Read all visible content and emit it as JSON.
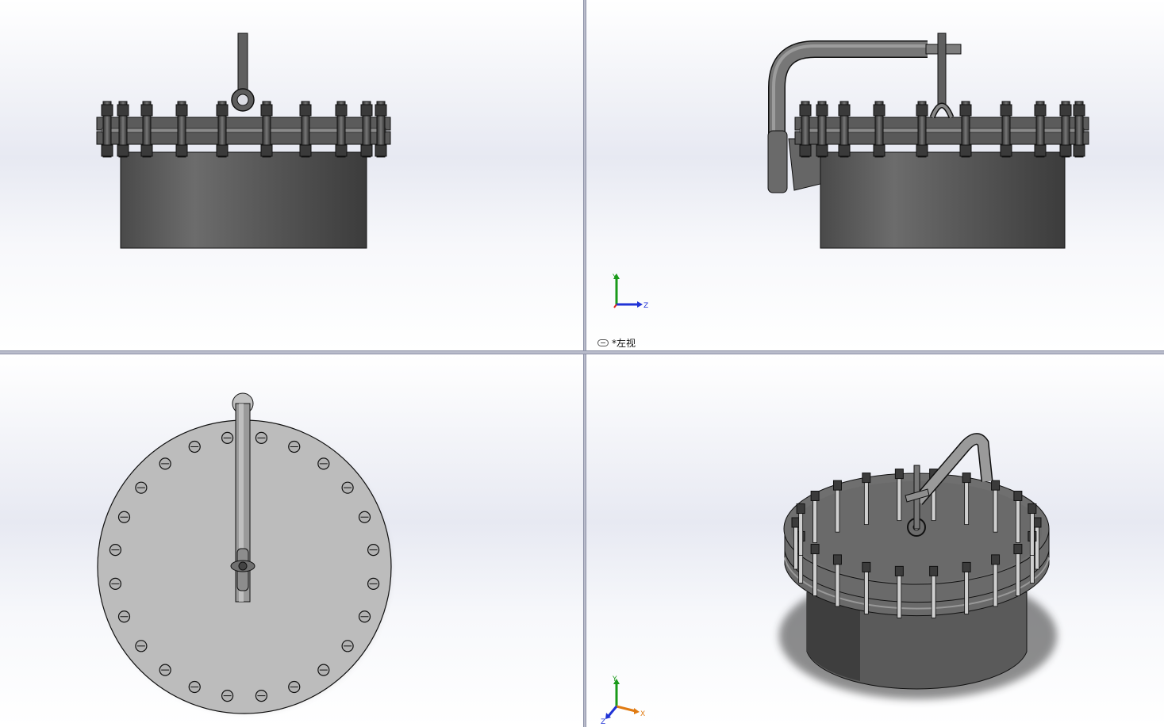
{
  "viewports": {
    "front": {
      "name": "front-view"
    },
    "left": {
      "name": "left-view",
      "label": "*左视"
    },
    "top": {
      "name": "top-view"
    },
    "iso": {
      "name": "isometric-view"
    }
  },
  "triad_left": {
    "y": "Y",
    "z": "Z"
  },
  "triad_iso": {
    "y": "Y",
    "z": "Z",
    "x": "X"
  },
  "colors": {
    "steel_dark": "#4d4d4d",
    "steel_mid": "#7b7b7b",
    "steel_light": "#b9b9b9",
    "edge": "#111111",
    "axis_y": "#1a9a1a",
    "axis_z": "#2033d6",
    "axis_x": "#e07b12"
  },
  "icons": {
    "link": "link-icon"
  }
}
